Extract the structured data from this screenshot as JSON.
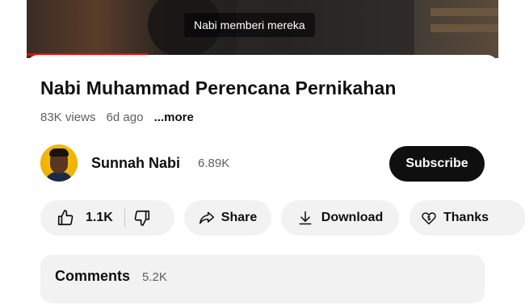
{
  "video": {
    "caption": "Nabi memberi mereka"
  },
  "details": {
    "title": "Nabi Muhammad Perencana Pernikahan",
    "views": "83K views",
    "age": "6d ago",
    "more_label": "...more"
  },
  "channel": {
    "name": "Sunnah Nabi",
    "subscribers": "6.89K",
    "subscribe_label": "Subscribe"
  },
  "actions": {
    "like_count": "1.1K",
    "share_label": "Share",
    "download_label": "Download",
    "thanks_label": "Thanks"
  },
  "comments": {
    "label": "Comments",
    "count": "5.2K"
  },
  "colors": {
    "progress": "#ff0000",
    "subscribe_bg": "#0f0f0f",
    "pill_bg": "#f2f2f2"
  },
  "icons": [
    "thumbs-up-icon",
    "thumbs-down-icon",
    "share-arrow-icon",
    "download-icon",
    "thanks-heart-dollar-icon",
    "channel-avatar"
  ]
}
